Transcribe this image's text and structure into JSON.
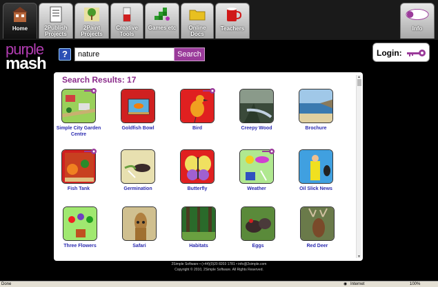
{
  "tabs": [
    {
      "label": "Home"
    },
    {
      "label": "2Publish Projects"
    },
    {
      "label": "2Paint Projects"
    },
    {
      "label": "Creative Tools"
    },
    {
      "label": "Games etc"
    },
    {
      "label": "Online Docs"
    },
    {
      "label": "Teachers"
    },
    {
      "label": "Info"
    }
  ],
  "logo": {
    "line1": "purple",
    "line2": "mash"
  },
  "help_label": "?",
  "search": {
    "value": "nature",
    "button": "Search"
  },
  "login": {
    "label": "Login:"
  },
  "results": {
    "title": "Search Results: 17",
    "items": [
      {
        "caption": "Simple City Garden Centre",
        "locked": true
      },
      {
        "caption": "Goldfish Bowl",
        "locked": false
      },
      {
        "caption": "Bird",
        "locked": true
      },
      {
        "caption": "Creepy Wood",
        "locked": false
      },
      {
        "caption": "Brochure",
        "locked": false
      },
      {
        "caption": "Fish Tank",
        "locked": true
      },
      {
        "caption": "Germination",
        "locked": false
      },
      {
        "caption": "Butterfly",
        "locked": false
      },
      {
        "caption": "Weather",
        "locked": true
      },
      {
        "caption": "Oil Slick News",
        "locked": false
      },
      {
        "caption": "Three Flowers",
        "locked": false
      },
      {
        "caption": "Safari",
        "locked": false
      },
      {
        "caption": "Habitats",
        "locked": false
      },
      {
        "caption": "Eggs",
        "locked": false
      },
      {
        "caption": "Red Deer",
        "locked": false
      }
    ]
  },
  "footer": {
    "line1": "2Simple Software  •  (+44)(0)20 8203 1781  •  info@2simple.com",
    "line2": "Copyright © 2010, 2Simple Software. All Rights Reserved."
  },
  "statusbar": {
    "left": "Done",
    "zone": "Internet",
    "zoom": "100%"
  },
  "colors": {
    "brand_purple": "#9a3a9a",
    "caption_blue": "#2a2ab0",
    "title_purple": "#8a2a8a"
  }
}
